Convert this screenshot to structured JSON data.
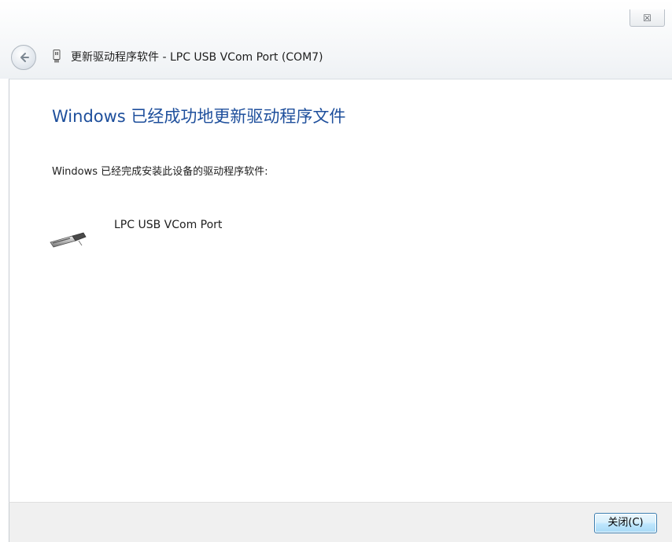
{
  "window": {
    "close_glyph": "☒",
    "title": "更新驱动程序软件 - LPC USB VCom Port (COM7)"
  },
  "main": {
    "heading": "Windows 已经成功地更新驱动程序文件",
    "description": "Windows 已经完成安装此设备的驱动程序软件:",
    "device_name": "LPC USB VCom Port"
  },
  "footer": {
    "close_button_label": "关闭(C)"
  },
  "colors": {
    "heading": "#1e4f9c",
    "button_border": "#3c7fb1"
  },
  "icons": {
    "back": "back-arrow-icon",
    "title": "usb-plug-icon",
    "device": "usb-cable-icon",
    "close": "close-icon"
  }
}
